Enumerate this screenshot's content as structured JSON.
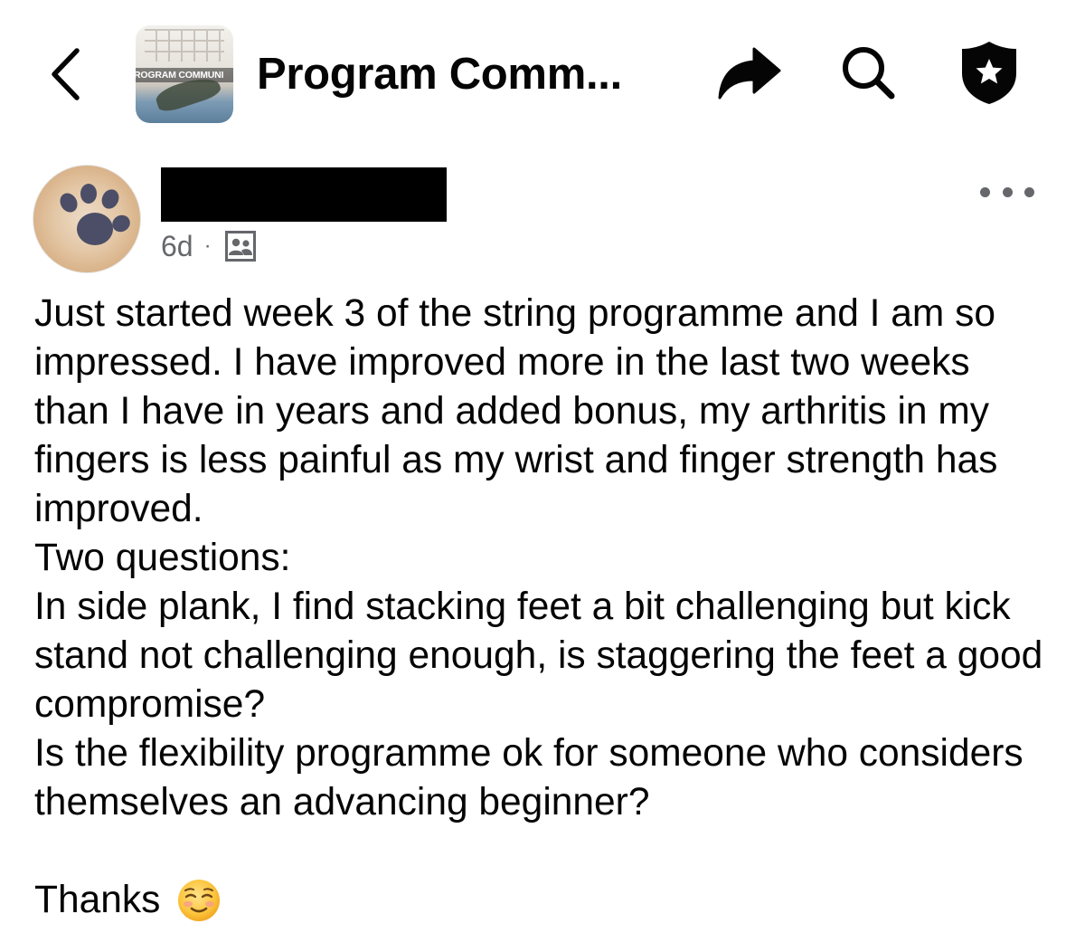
{
  "header": {
    "group_name": "Program Comm...",
    "thumbnail_banner": "ROGRAM COMMUNI",
    "icons": {
      "back": "chevron-left-icon",
      "share": "share-arrow-icon",
      "search": "search-icon",
      "admin": "shield-star-icon"
    }
  },
  "post": {
    "author_name_redacted": true,
    "time_ago": "6d",
    "separator": "·",
    "privacy_icon": "members-icon",
    "more_icon": "ellipsis-icon",
    "paragraphs": [
      "Just started week 3 of the string programme and I am so impressed. I have improved more in the last two weeks than I have in years and added bonus, my arthritis in my fingers is less painful as my wrist and finger strength has improved.",
      "Two questions:",
      "In side plank, I find stacking feet a bit challenging but kick stand not challenging enough, is staggering the feet a good compromise?",
      "Is the flexibility programme ok for someone who considers themselves an advancing beginner?"
    ],
    "closing": "Thanks",
    "closing_emoji": "smiling-face-icon"
  },
  "colors": {
    "text_primary": "#050505",
    "text_secondary": "#65676b",
    "background": "#ffffff",
    "redaction": "#000000"
  }
}
